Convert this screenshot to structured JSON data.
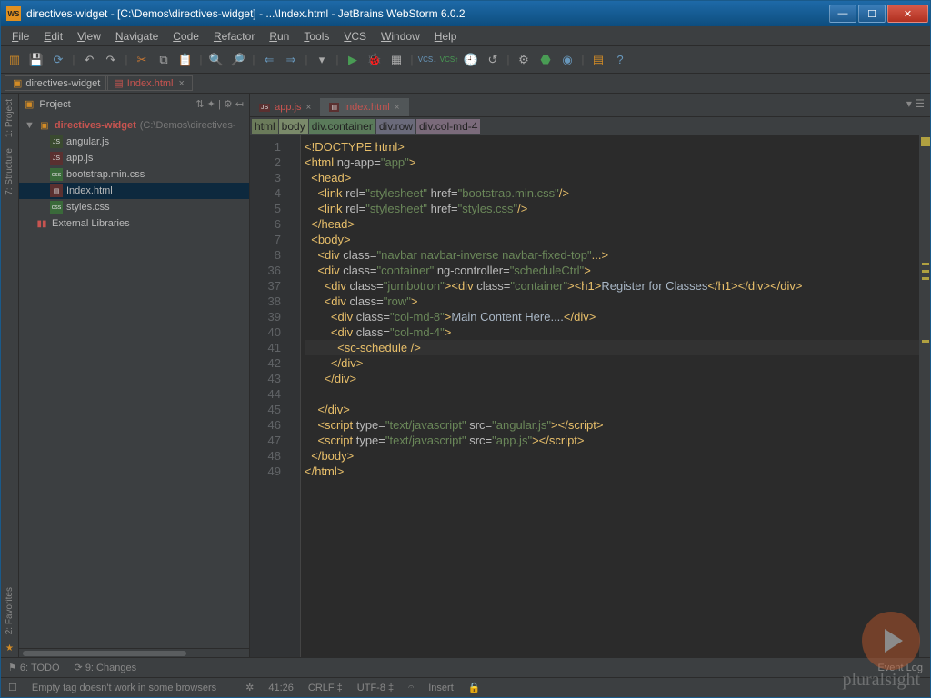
{
  "window": {
    "title": "directives-widget - [C:\\Demos\\directives-widget] - ...\\Index.html - JetBrains WebStorm 6.0.2"
  },
  "menu": [
    "File",
    "Edit",
    "View",
    "Navigate",
    "Code",
    "Refactor",
    "Run",
    "Tools",
    "VCS",
    "Window",
    "Help"
  ],
  "navcrumbs": {
    "project": "directives-widget",
    "file": "Index.html"
  },
  "projectPane": {
    "title": "Project",
    "root": "directives-widget",
    "rootPath": "(C:\\Demos\\directives-",
    "files": [
      "angular.js",
      "app.js",
      "bootstrap.min.css",
      "Index.html",
      "styles.css"
    ],
    "external": "External Libraries"
  },
  "editorTabs": [
    {
      "label": "app.js",
      "icon": "js"
    },
    {
      "label": "Index.html",
      "icon": "html"
    }
  ],
  "breadcrumb": [
    "html",
    "body",
    "div.container",
    "div.row",
    "div.col-md-4"
  ],
  "lineNumbers": [
    "1",
    "2",
    "3",
    "4",
    "5",
    "6",
    "7",
    "8",
    "36",
    "37",
    "38",
    "39",
    "40",
    "41",
    "42",
    "43",
    "44",
    "45",
    "46",
    "47",
    "48",
    "49"
  ],
  "code": [
    {
      "indent": 0,
      "html": "<span class='tag'>&lt;!DOCTYPE html&gt;</span>"
    },
    {
      "indent": 0,
      "html": "<span class='tag'>&lt;html </span><span class='attr'>ng-app=</span><span class='str'>\"app\"</span><span class='tag'>&gt;</span>"
    },
    {
      "indent": 1,
      "html": "<span class='tag'>&lt;head&gt;</span>"
    },
    {
      "indent": 2,
      "html": "<span class='tag'>&lt;link </span><span class='attr'>rel=</span><span class='str'>\"stylesheet\"</span><span class='attr'> href=</span><span class='str'>\"bootstrap.min.css\"</span><span class='tag'>/&gt;</span>"
    },
    {
      "indent": 2,
      "html": "<span class='tag'>&lt;link </span><span class='attr'>rel=</span><span class='str'>\"stylesheet\"</span><span class='attr'> href=</span><span class='str'>\"styles.css\"</span><span class='tag'>/&gt;</span>"
    },
    {
      "indent": 1,
      "html": "<span class='tag'>&lt;/head&gt;</span>"
    },
    {
      "indent": 1,
      "html": "<span class='tag'>&lt;body&gt;</span>"
    },
    {
      "indent": 2,
      "html": "<span class='tag'>&lt;div </span><span class='attr'>class=</span><span class='str'>\"navbar navbar-inverse navbar-fixed-top\"</span><span class='tag'>...&gt;</span>"
    },
    {
      "indent": 2,
      "html": "<span class='tag'>&lt;div </span><span class='attr'>class=</span><span class='str'>\"container\"</span><span class='attr'> ng-controller=</span><span class='str'>\"scheduleCtrl\"</span><span class='tag'>&gt;</span>"
    },
    {
      "indent": 3,
      "html": "<span class='tag'>&lt;div </span><span class='attr'>class=</span><span class='str'>\"jumbotron\"</span><span class='tag'>&gt;&lt;div </span><span class='attr'>class=</span><span class='str'>\"container\"</span><span class='tag'>&gt;&lt;h1&gt;</span><span class='txt'>Register for Classes</span><span class='tag'>&lt;/h1&gt;&lt;/div&gt;&lt;/div&gt;</span>"
    },
    {
      "indent": 3,
      "html": "<span class='tag'>&lt;div </span><span class='attr'>class=</span><span class='str'>\"row\"</span><span class='tag'>&gt;</span>"
    },
    {
      "indent": 4,
      "html": "<span class='tag'>&lt;div </span><span class='attr'>class=</span><span class='str'>\"col-md-8\"</span><span class='tag'>&gt;</span><span class='txt'>Main Content Here....</span><span class='tag'>&lt;/div&gt;</span>"
    },
    {
      "indent": 4,
      "html": "<span class='tag'>&lt;div </span><span class='attr'>class=</span><span class='str'>\"col-md-4\"</span><span class='tag'>&gt;</span>"
    },
    {
      "indent": 5,
      "hl": true,
      "html": "<span class='tag'>&lt;sc-schedule /&gt;</span>"
    },
    {
      "indent": 4,
      "html": "<span class='tag'>&lt;/div&gt;</span>"
    },
    {
      "indent": 3,
      "html": "<span class='tag'>&lt;/div&gt;</span>"
    },
    {
      "indent": 0,
      "html": ""
    },
    {
      "indent": 2,
      "html": "<span class='tag'>&lt;/div&gt;</span>"
    },
    {
      "indent": 2,
      "html": "<span class='tag'>&lt;script </span><span class='attr'>type=</span><span class='str'>\"text/javascript\"</span><span class='attr'> src=</span><span class='str'>\"angular.js\"</span><span class='tag'>&gt;&lt;/script&gt;</span>"
    },
    {
      "indent": 2,
      "html": "<span class='tag'>&lt;script </span><span class='attr'>type=</span><span class='str'>\"text/javascript\"</span><span class='attr'> src=</span><span class='str'>\"app.js\"</span><span class='tag'>&gt;&lt;/script&gt;</span>"
    },
    {
      "indent": 1,
      "html": "<span class='tag'>&lt;/body&gt;</span>"
    },
    {
      "indent": 0,
      "html": "<span class='tag'>&lt;/html&gt;</span>"
    }
  ],
  "status": {
    "todo": "6: TODO",
    "changes": "9: Changes",
    "eventlog": "Event Log",
    "hint": "Empty tag doesn't work in some browsers",
    "pos": "41:26",
    "sep": "CRLF ‡",
    "enc": "UTF-8 ‡",
    "insert": "Insert"
  },
  "sidelabels": {
    "project": "1: Project",
    "structure": "7: Structure",
    "favorites": "2: Favorites"
  },
  "watermark": "pluralsight"
}
